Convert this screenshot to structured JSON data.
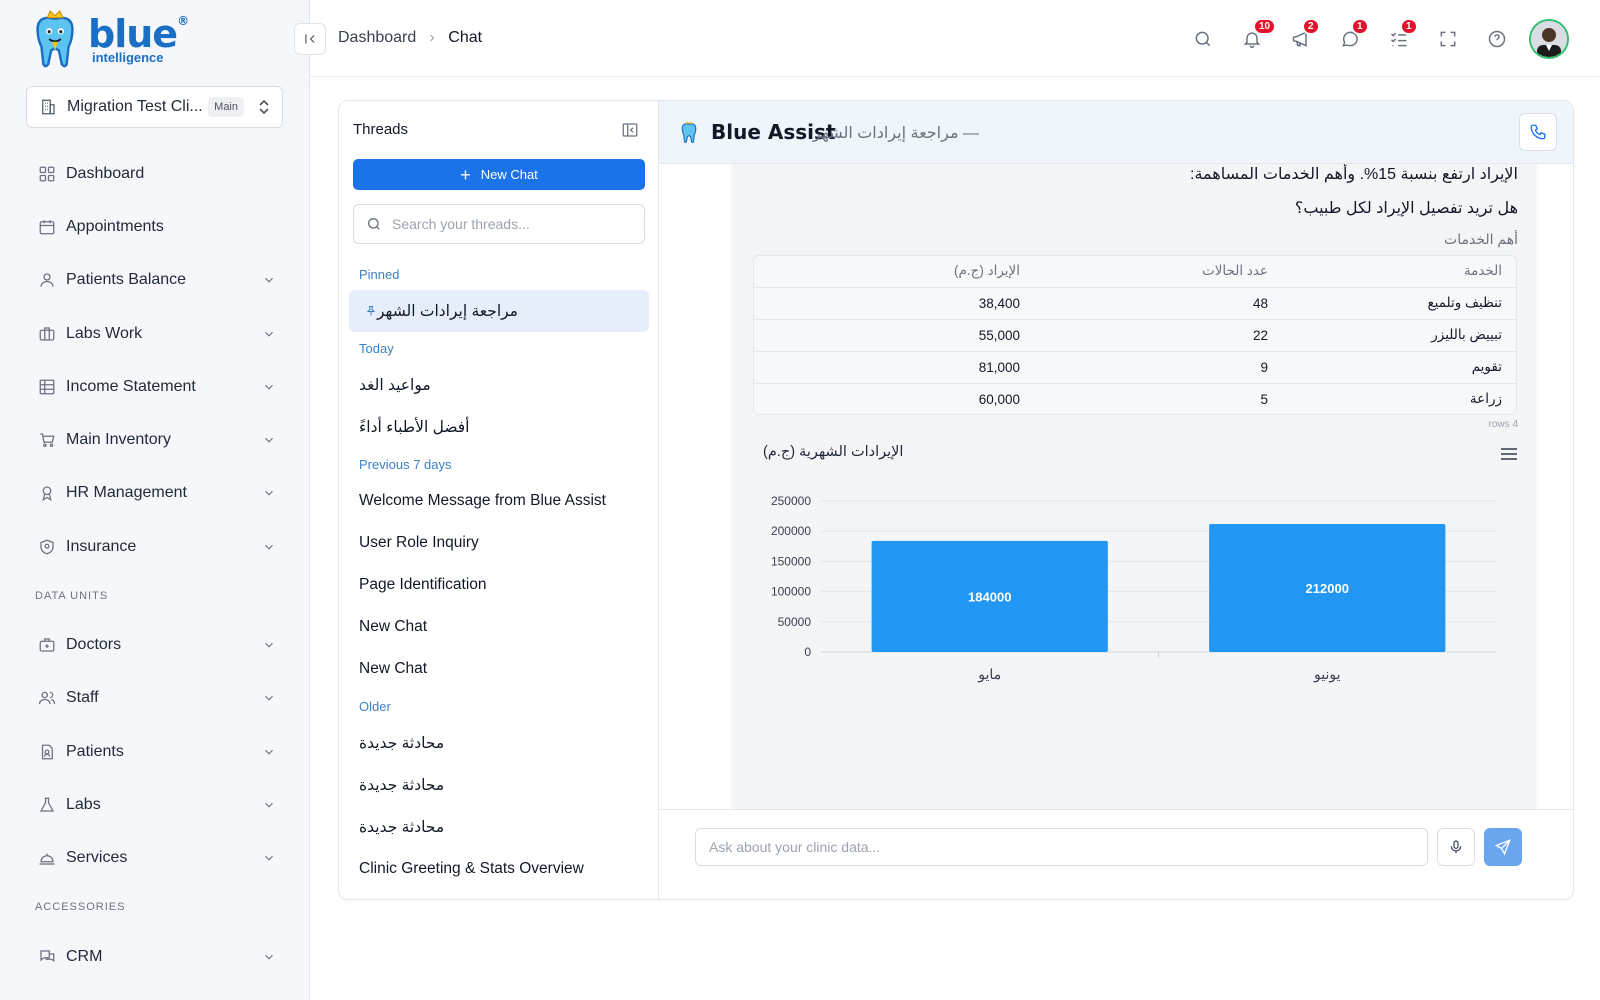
{
  "brand": {
    "name": "blue",
    "tagline": "intelligence"
  },
  "clinic": {
    "name": "Migration Test Cli...",
    "badge": "Main"
  },
  "sidebar": {
    "items": [
      {
        "label": "Dashboard",
        "icon": "dashboard-grid-icon",
        "chevron": false
      },
      {
        "label": "Appointments",
        "icon": "calendar-icon",
        "chevron": false
      },
      {
        "label": "Patients Balance",
        "icon": "user-icon",
        "chevron": true
      },
      {
        "label": "Labs Work",
        "icon": "briefcase-icon",
        "chevron": true
      },
      {
        "label": "Income Statement",
        "icon": "table-icon",
        "chevron": true
      },
      {
        "label": "Main Inventory",
        "icon": "cart-icon",
        "chevron": true
      },
      {
        "label": "HR Management",
        "icon": "award-icon",
        "chevron": true
      },
      {
        "label": "Insurance",
        "icon": "shield-icon",
        "chevron": true
      }
    ],
    "section_data_units": "DATA UNITS",
    "data_units": [
      {
        "label": "Doctors",
        "icon": "medical-bag-icon",
        "chevron": true
      },
      {
        "label": "Staff",
        "icon": "users-icon",
        "chevron": true
      },
      {
        "label": "Patients",
        "icon": "file-user-icon",
        "chevron": true
      },
      {
        "label": "Labs",
        "icon": "flask-icon",
        "chevron": true
      },
      {
        "label": "Services",
        "icon": "service-bell-icon",
        "chevron": true
      }
    ],
    "section_accessories": "ACCESSORIES",
    "accessories": [
      {
        "label": "CRM",
        "icon": "chat-bubbles-icon",
        "chevron": true
      }
    ]
  },
  "header": {
    "breadcrumb": [
      "Dashboard",
      "Chat"
    ],
    "badges": {
      "notifications": "10",
      "announcements": "2",
      "messages": "1",
      "tasks": "1"
    }
  },
  "threads": {
    "title": "Threads",
    "new_chat_label": "New Chat",
    "search_placeholder": "Search your threads...",
    "pinned_label": "Pinned",
    "pinned": [
      "مراجعة إيرادات الشهر"
    ],
    "today_label": "Today",
    "today": [
      "مواعيد الغد",
      "أفضل الأطباء أداءً"
    ],
    "prev7_label": "Previous 7 days",
    "prev7": [
      "Welcome Message from Blue Assist",
      "User Role Inquiry",
      "Page Identification",
      "New Chat",
      "New Chat"
    ],
    "older_label": "Older",
    "older": [
      "محادثة جديدة",
      "محادثة جديدة",
      "محادثة جديدة",
      "Clinic Greeting & Stats Overview"
    ]
  },
  "chat": {
    "assistant_name": "Blue Assist",
    "subtitle": "— مراجعة إيرادات الشهر",
    "message_line1": "الإيراد ارتفع بنسبة 15%. وأهم الخدمات المساهمة:",
    "message_line2": "هل تريد تفصيل الإيراد لكل طبيب؟",
    "table_caption": "أهم الخدمات",
    "table": {
      "headers": [
        "الخدمة",
        "عدد الحالات",
        "الإيراد (ج.م)"
      ],
      "rows": [
        [
          "تنظيف وتلميع",
          "48",
          "38,400"
        ],
        [
          "تبييض بالليزر",
          "22",
          "55,000"
        ],
        [
          "تقويم",
          "9",
          "81,000"
        ],
        [
          "زراعة",
          "5",
          "60,000"
        ]
      ]
    },
    "rows_count": "4 rows",
    "composer_placeholder": "Ask about your clinic data..."
  },
  "chart_data": {
    "type": "bar",
    "title": "الإيرادات الشهرية (ج.م)",
    "categories": [
      "مايو",
      "يونيو"
    ],
    "values": [
      184000,
      212000
    ],
    "ylim": [
      0,
      250000
    ],
    "yticks": [
      0,
      50000,
      100000,
      150000,
      200000,
      250000
    ],
    "xlabel": "",
    "ylabel": "",
    "grid": true,
    "bar_color": "#2196f3"
  },
  "colors": {
    "accent": "#1a73e8",
    "badge": "#e3132b",
    "brand": "#1a6fc4"
  }
}
